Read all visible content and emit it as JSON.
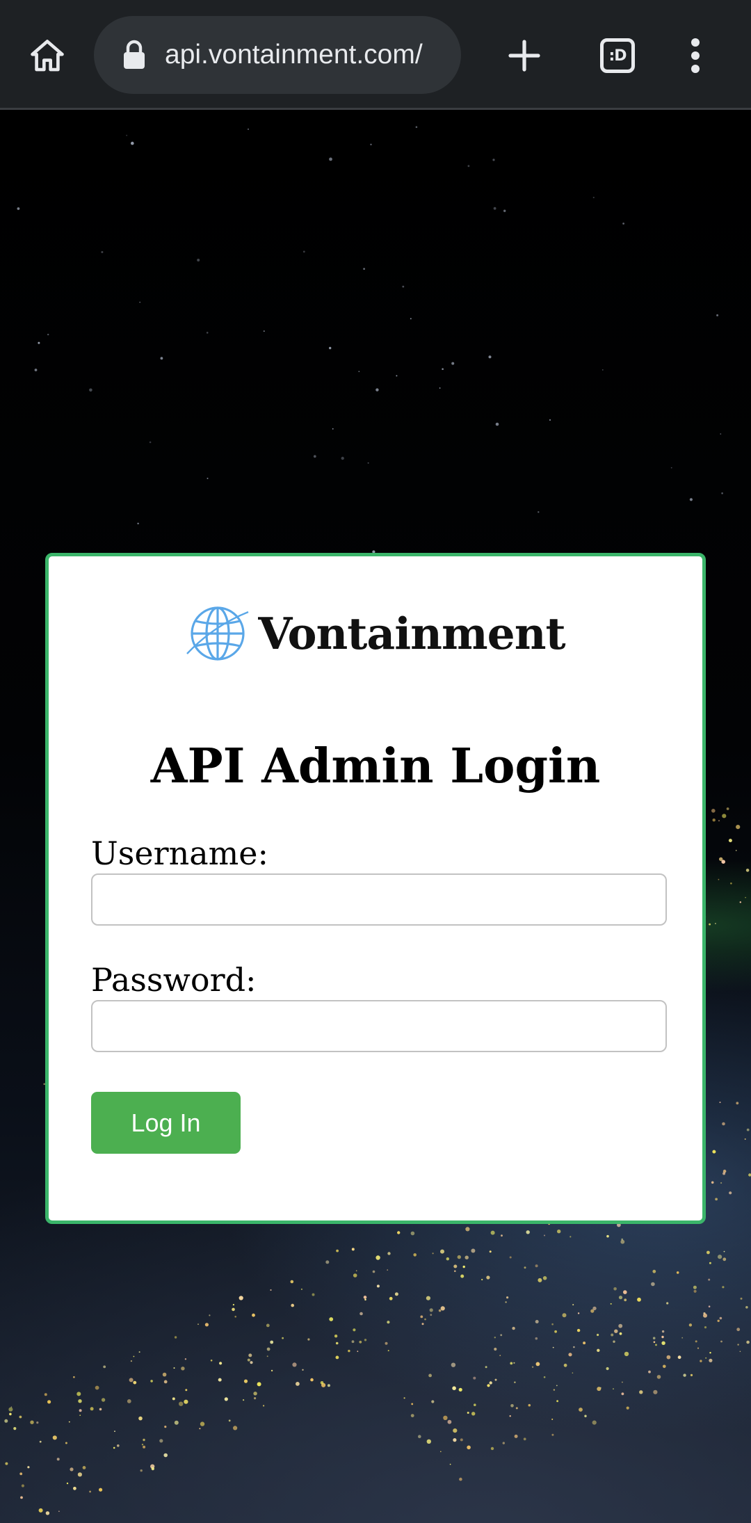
{
  "browser": {
    "url": "api.vontainment.com/",
    "icons": {
      "home": "home-icon",
      "lock": "lock-icon",
      "new_tab": "plus-icon",
      "tabs": "tab-switcher-icon",
      "menu": "more-vert-icon"
    },
    "tab_switcher_label": ":D",
    "colors": {
      "toolbar_bg": "#1e2124",
      "omnibox_bg": "#2f3337",
      "icon": "#e8eaed"
    }
  },
  "login_card": {
    "logo_text": "Vontainment",
    "logo_icon": "globe-icon",
    "title": "API Admin Login",
    "username_label": "Username:",
    "username_value": "",
    "password_label": "Password:",
    "password_value": "",
    "submit_label": "Log In",
    "colors": {
      "border": "#3bb56a",
      "button": "#4caf50",
      "globe": "#5aa7e8"
    }
  }
}
